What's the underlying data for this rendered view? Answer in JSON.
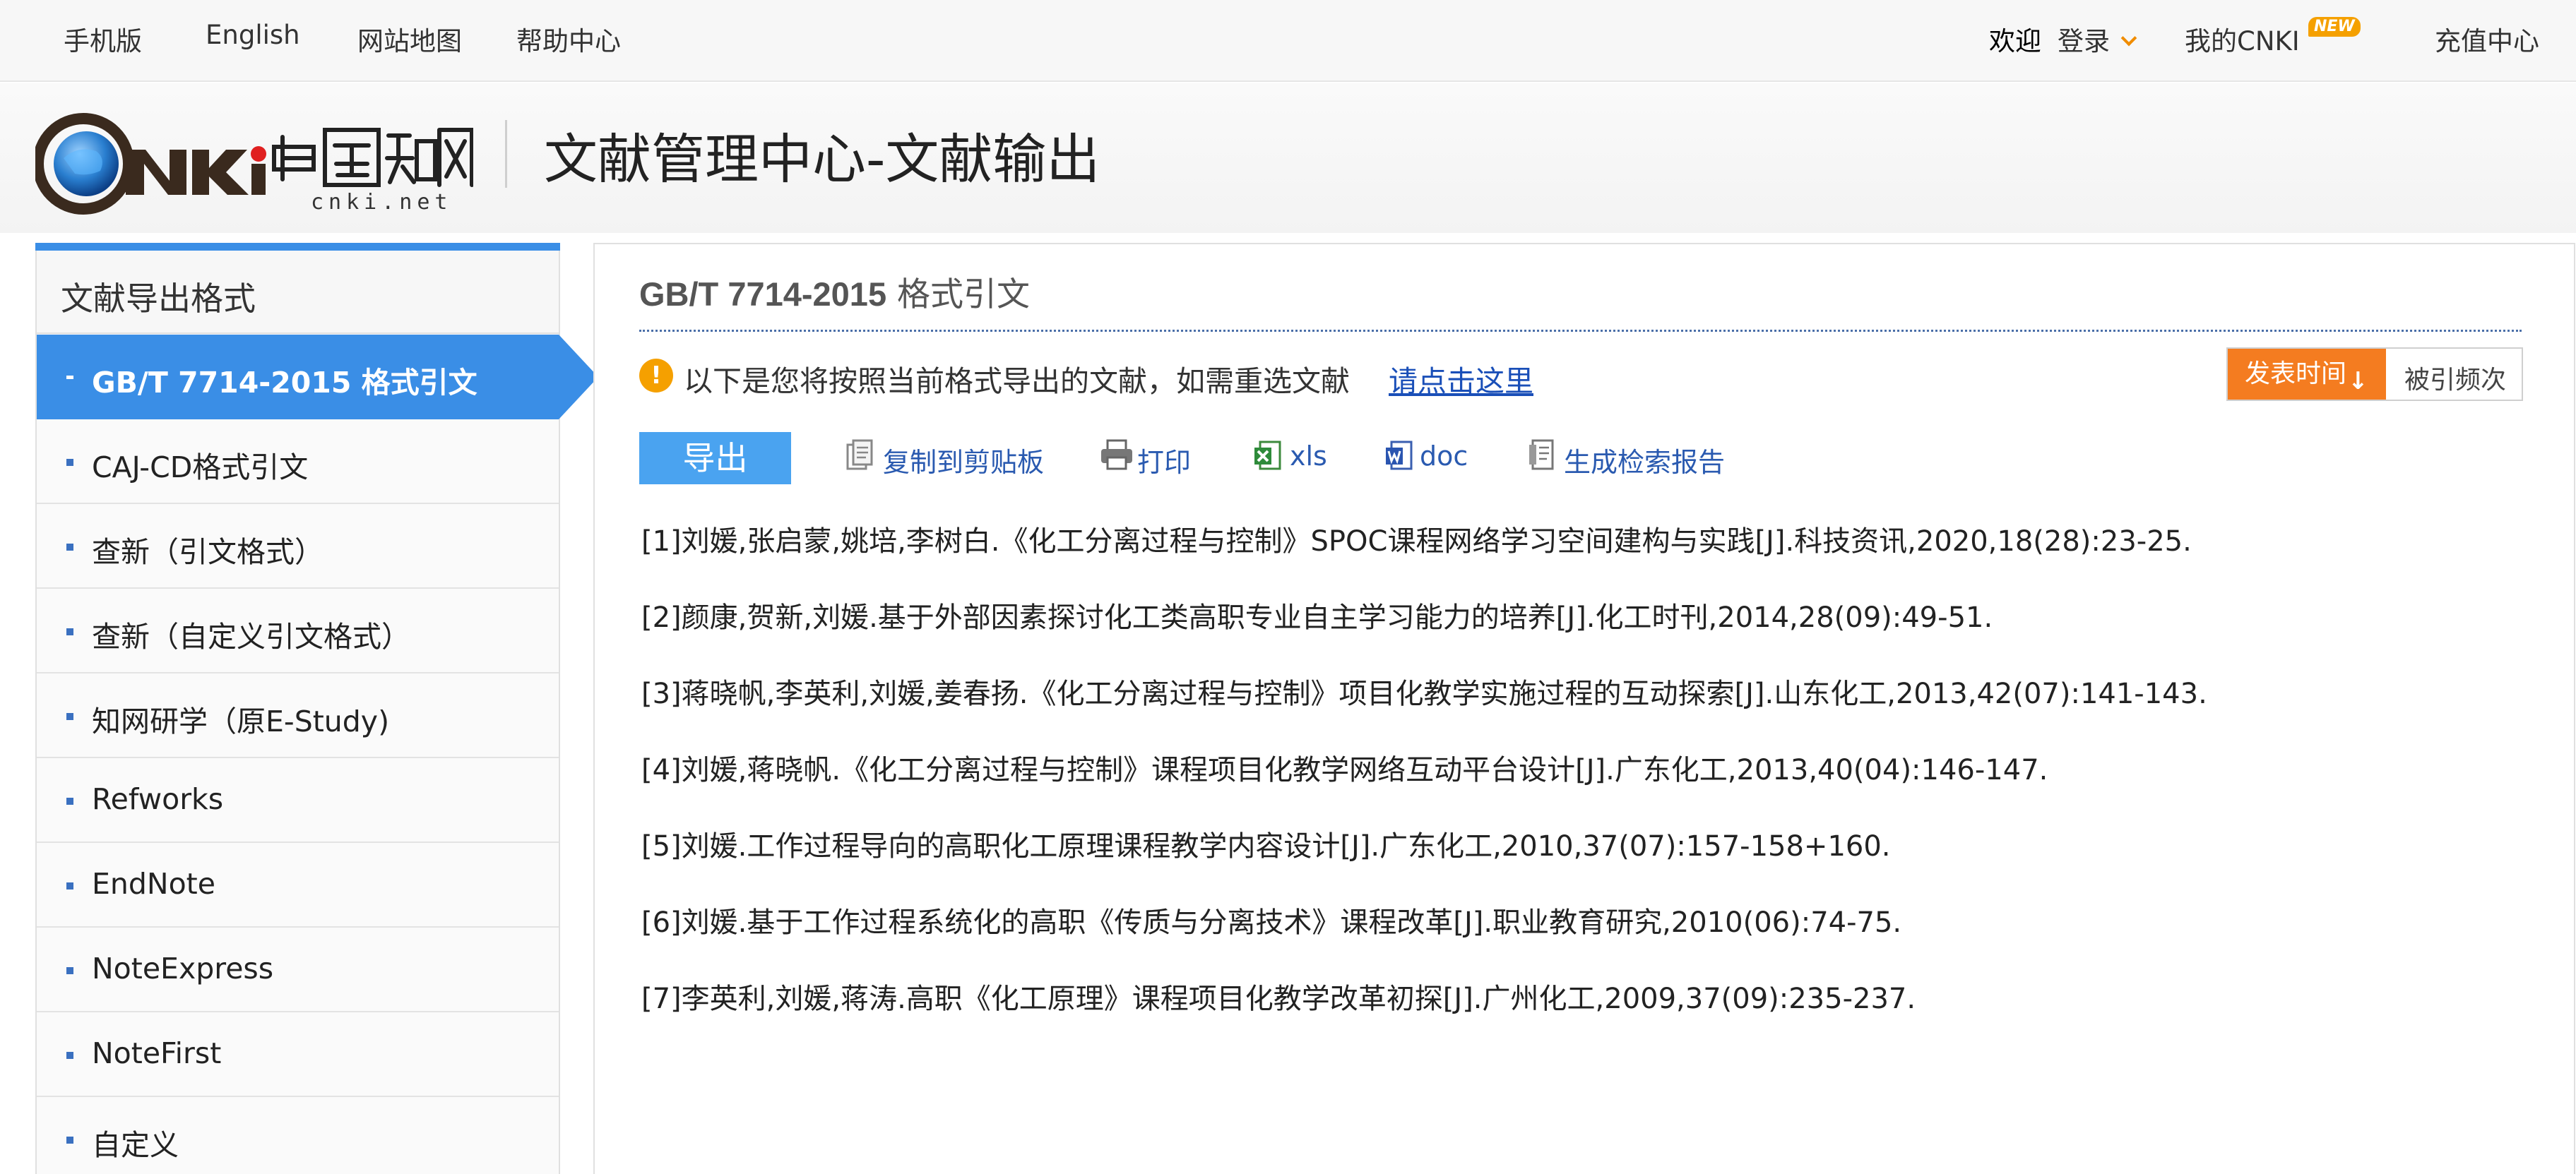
{
  "topbar": {
    "mobile": "手机版",
    "english": "English",
    "sitemap": "网站地图",
    "help": "帮助中心",
    "welcome": "欢迎",
    "login": "登录",
    "mycnki": "我的CNKI",
    "new_badge": "NEW",
    "recharge": "充值中心"
  },
  "header": {
    "logo_text": "CNKI 中国知网",
    "logo_sub": "cnki.net",
    "title": "文献管理中心-文献输出"
  },
  "sidebar": {
    "heading": "文献导出格式",
    "items": [
      {
        "label": "GB/T 7714-2015 格式引文",
        "active": true
      },
      {
        "label": "CAJ-CD格式引文"
      },
      {
        "label": "查新（引文格式）"
      },
      {
        "label": "查新（自定义引文格式）"
      },
      {
        "label": "知网研学（原E-Study)"
      },
      {
        "label": "Refworks"
      },
      {
        "label": "EndNote"
      },
      {
        "label": "NoteExpress"
      },
      {
        "label": "NoteFirst"
      },
      {
        "label": "自定义"
      }
    ]
  },
  "main": {
    "title_code": "GB/T 7714-2015",
    "title_rest": " 格式引文",
    "notice": "以下是您将按照当前格式导出的文献，如需重选文献",
    "notice_link": "请点击这里",
    "sort_active": "发表时间",
    "sort_other": "被引频次",
    "export_label": "导出",
    "tools": {
      "copy": "复制到剪贴板",
      "print": "打印",
      "xls": "xls",
      "doc": "doc",
      "report": "生成检索报告"
    },
    "references": [
      "[1]刘媛,张启蒙,姚培,李树白.《化工分离过程与控制》SPOC课程网络学习空间建构与实践[J].科技资讯,2020,18(28):23-25.",
      "[2]颜康,贺新,刘媛.基于外部因素探讨化工类高职专业自主学习能力的培养[J].化工时刊,2014,28(09):49-51.",
      "[3]蒋晓帆,李英利,刘媛,姜春扬.《化工分离过程与控制》项目化教学实施过程的互动探索[J].山东化工,2013,42(07):141-143.",
      "[4]刘媛,蒋晓帆.《化工分离过程与控制》课程项目化教学网络互动平台设计[J].广东化工,2013,40(04):146-147.",
      "[5]刘媛.工作过程导向的高职化工原理课程教学内容设计[J].广东化工,2010,37(07):157-158+160.",
      "[6]刘媛.基于工作过程系统化的高职《传质与分离技术》课程改革[J].职业教育研究,2010(06):74-75.",
      "[7]李英利,刘媛,蒋涛.高职《化工原理》课程项目化教学改革初探[J].广州化工,2009,37(09):235-237."
    ]
  },
  "colors": {
    "accent": "#3a8ee6",
    "sort_active_bg": "#f47c20",
    "link": "#1a4fb8",
    "badge": "#f5a000"
  }
}
